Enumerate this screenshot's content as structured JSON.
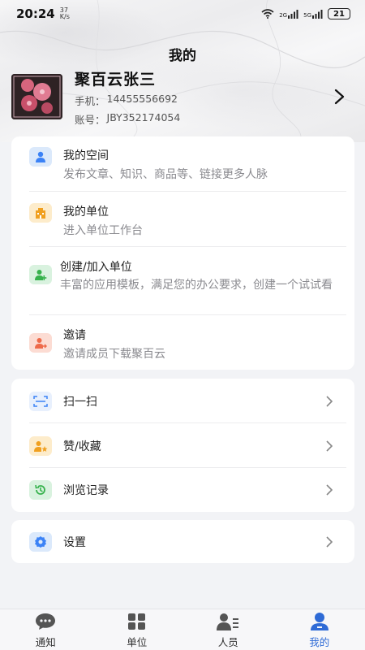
{
  "status_bar": {
    "time": "20:24",
    "speed_value": "37",
    "speed_unit": "K/s",
    "sig1": "2G",
    "sig2": "5G",
    "battery": "21"
  },
  "header": {
    "title": "我的"
  },
  "profile": {
    "name": "聚百云张三",
    "phone_label": "手机：",
    "phone": "14455556692",
    "account_label": "账号：",
    "account": "JBY352174054"
  },
  "menu_main": [
    {
      "title": "我的空间",
      "subtitle": "发布文章、知识、商品等、链接更多人脉",
      "icon": "person-icon",
      "color": "#3b82f6",
      "bg": "#dbe9fb"
    },
    {
      "title": "我的单位",
      "subtitle": "进入单位工作台",
      "icon": "building-icon",
      "color": "#f0a020",
      "bg": "#fdeccb"
    },
    {
      "title": "创建/加入单位",
      "subtitle": "丰富的应用模板，满足您的办公要求，创建一个试试看",
      "icon": "add-person-icon",
      "color": "#37b24d",
      "bg": "#d9f2df"
    },
    {
      "title": "邀请",
      "subtitle": "邀请成员下载聚百云",
      "icon": "invite-icon",
      "color": "#ee6a4a",
      "bg": "#fcdcd3"
    }
  ],
  "menu_tools": [
    {
      "title": "扫一扫",
      "icon": "scan-icon",
      "color": "#3b82f6",
      "bg": "#e8f0fd"
    },
    {
      "title": "赞/收藏",
      "icon": "star-person-icon",
      "color": "#f0a020",
      "bg": "#fdeccb"
    },
    {
      "title": "浏览记录",
      "icon": "history-icon",
      "color": "#37b24d",
      "bg": "#d9f2df"
    }
  ],
  "menu_settings": [
    {
      "title": "设置",
      "icon": "gear-icon",
      "color": "#3b82f6",
      "bg": "#dbe9fb"
    }
  ],
  "tabs": [
    {
      "label": "通知",
      "icon": "chat-icon",
      "active": false
    },
    {
      "label": "单位",
      "icon": "grid-icon",
      "active": false
    },
    {
      "label": "人员",
      "icon": "contacts-icon",
      "active": false
    },
    {
      "label": "我的",
      "icon": "profile-icon",
      "active": true
    }
  ],
  "colors": {
    "accent": "#2f6bd6",
    "inactive_tab": "#555555"
  }
}
